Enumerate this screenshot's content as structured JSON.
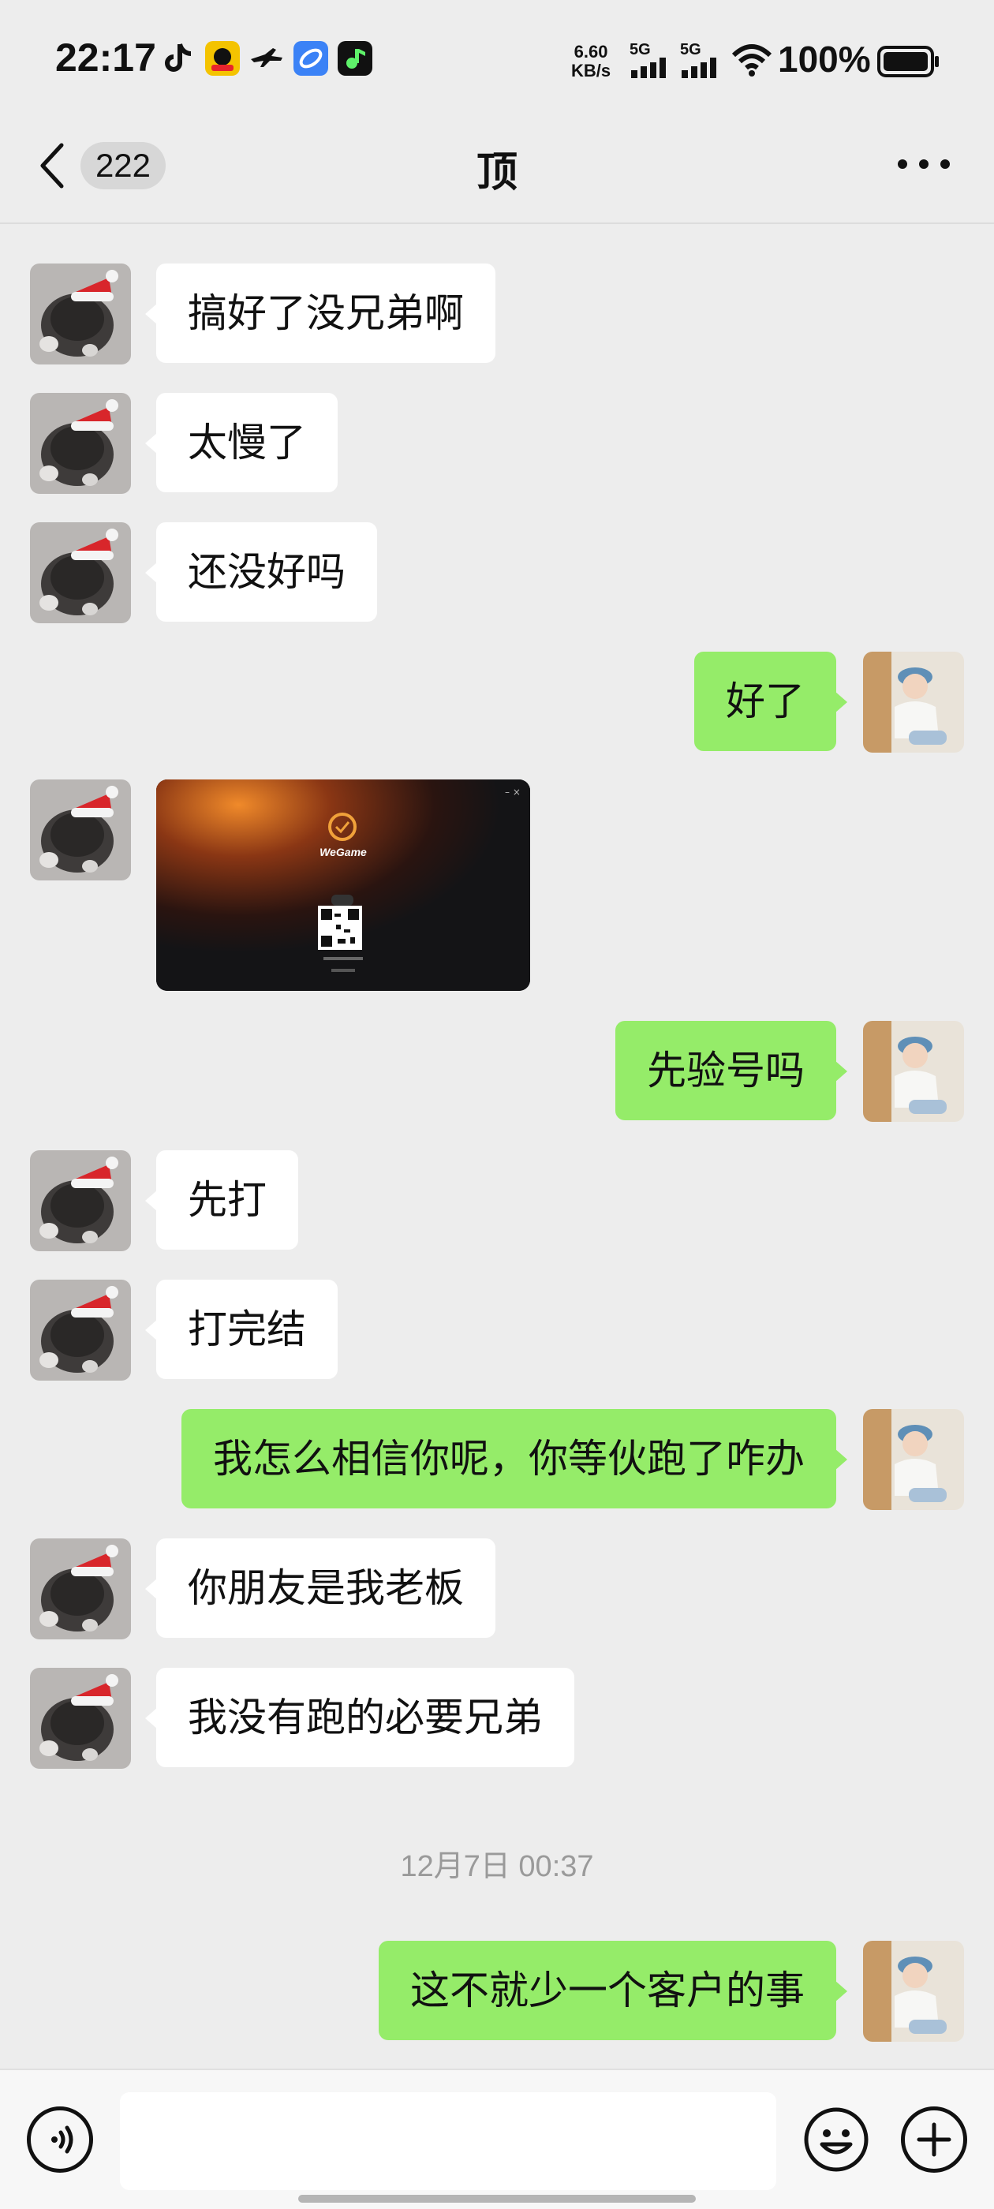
{
  "status_bar": {
    "time": "22:17",
    "net_speed_value": "6.60",
    "net_speed_unit": "KB/s",
    "sim1": "5G",
    "sim2": "5G",
    "battery": "100%",
    "notification_icons": [
      "tiktok-icon",
      "game-app-icon",
      "airplane-app-icon",
      "browser-app-icon",
      "music-app-icon"
    ]
  },
  "header": {
    "unread_count": "222",
    "title": "顶"
  },
  "messages": [
    {
      "side": "in",
      "type": "text",
      "text": "搞好了没兄弟啊"
    },
    {
      "side": "in",
      "type": "text",
      "text": "太慢了"
    },
    {
      "side": "in",
      "type": "text",
      "text": "还没好吗"
    },
    {
      "side": "out",
      "type": "text",
      "text": "好了"
    },
    {
      "side": "in",
      "type": "image",
      "app_name": "WeGame"
    },
    {
      "side": "out",
      "type": "text",
      "text": "先验号吗"
    },
    {
      "side": "in",
      "type": "text",
      "text": "先打"
    },
    {
      "side": "in",
      "type": "text",
      "text": "打完结"
    },
    {
      "side": "out",
      "type": "text",
      "text": "我怎么相信你呢，你等伙跑了咋办"
    },
    {
      "side": "in",
      "type": "text",
      "text": "你朋友是我老板"
    },
    {
      "side": "in",
      "type": "text",
      "text": "我没有跑的必要兄弟"
    },
    {
      "side": "out",
      "type": "text",
      "text": "这不就少一个客户的事"
    }
  ],
  "timestamp": "12月7日 00:37",
  "input": {
    "value": "",
    "placeholder": ""
  },
  "colors": {
    "background": "#ededed",
    "bubble_out": "#95ec69",
    "bubble_in": "#ffffff"
  }
}
